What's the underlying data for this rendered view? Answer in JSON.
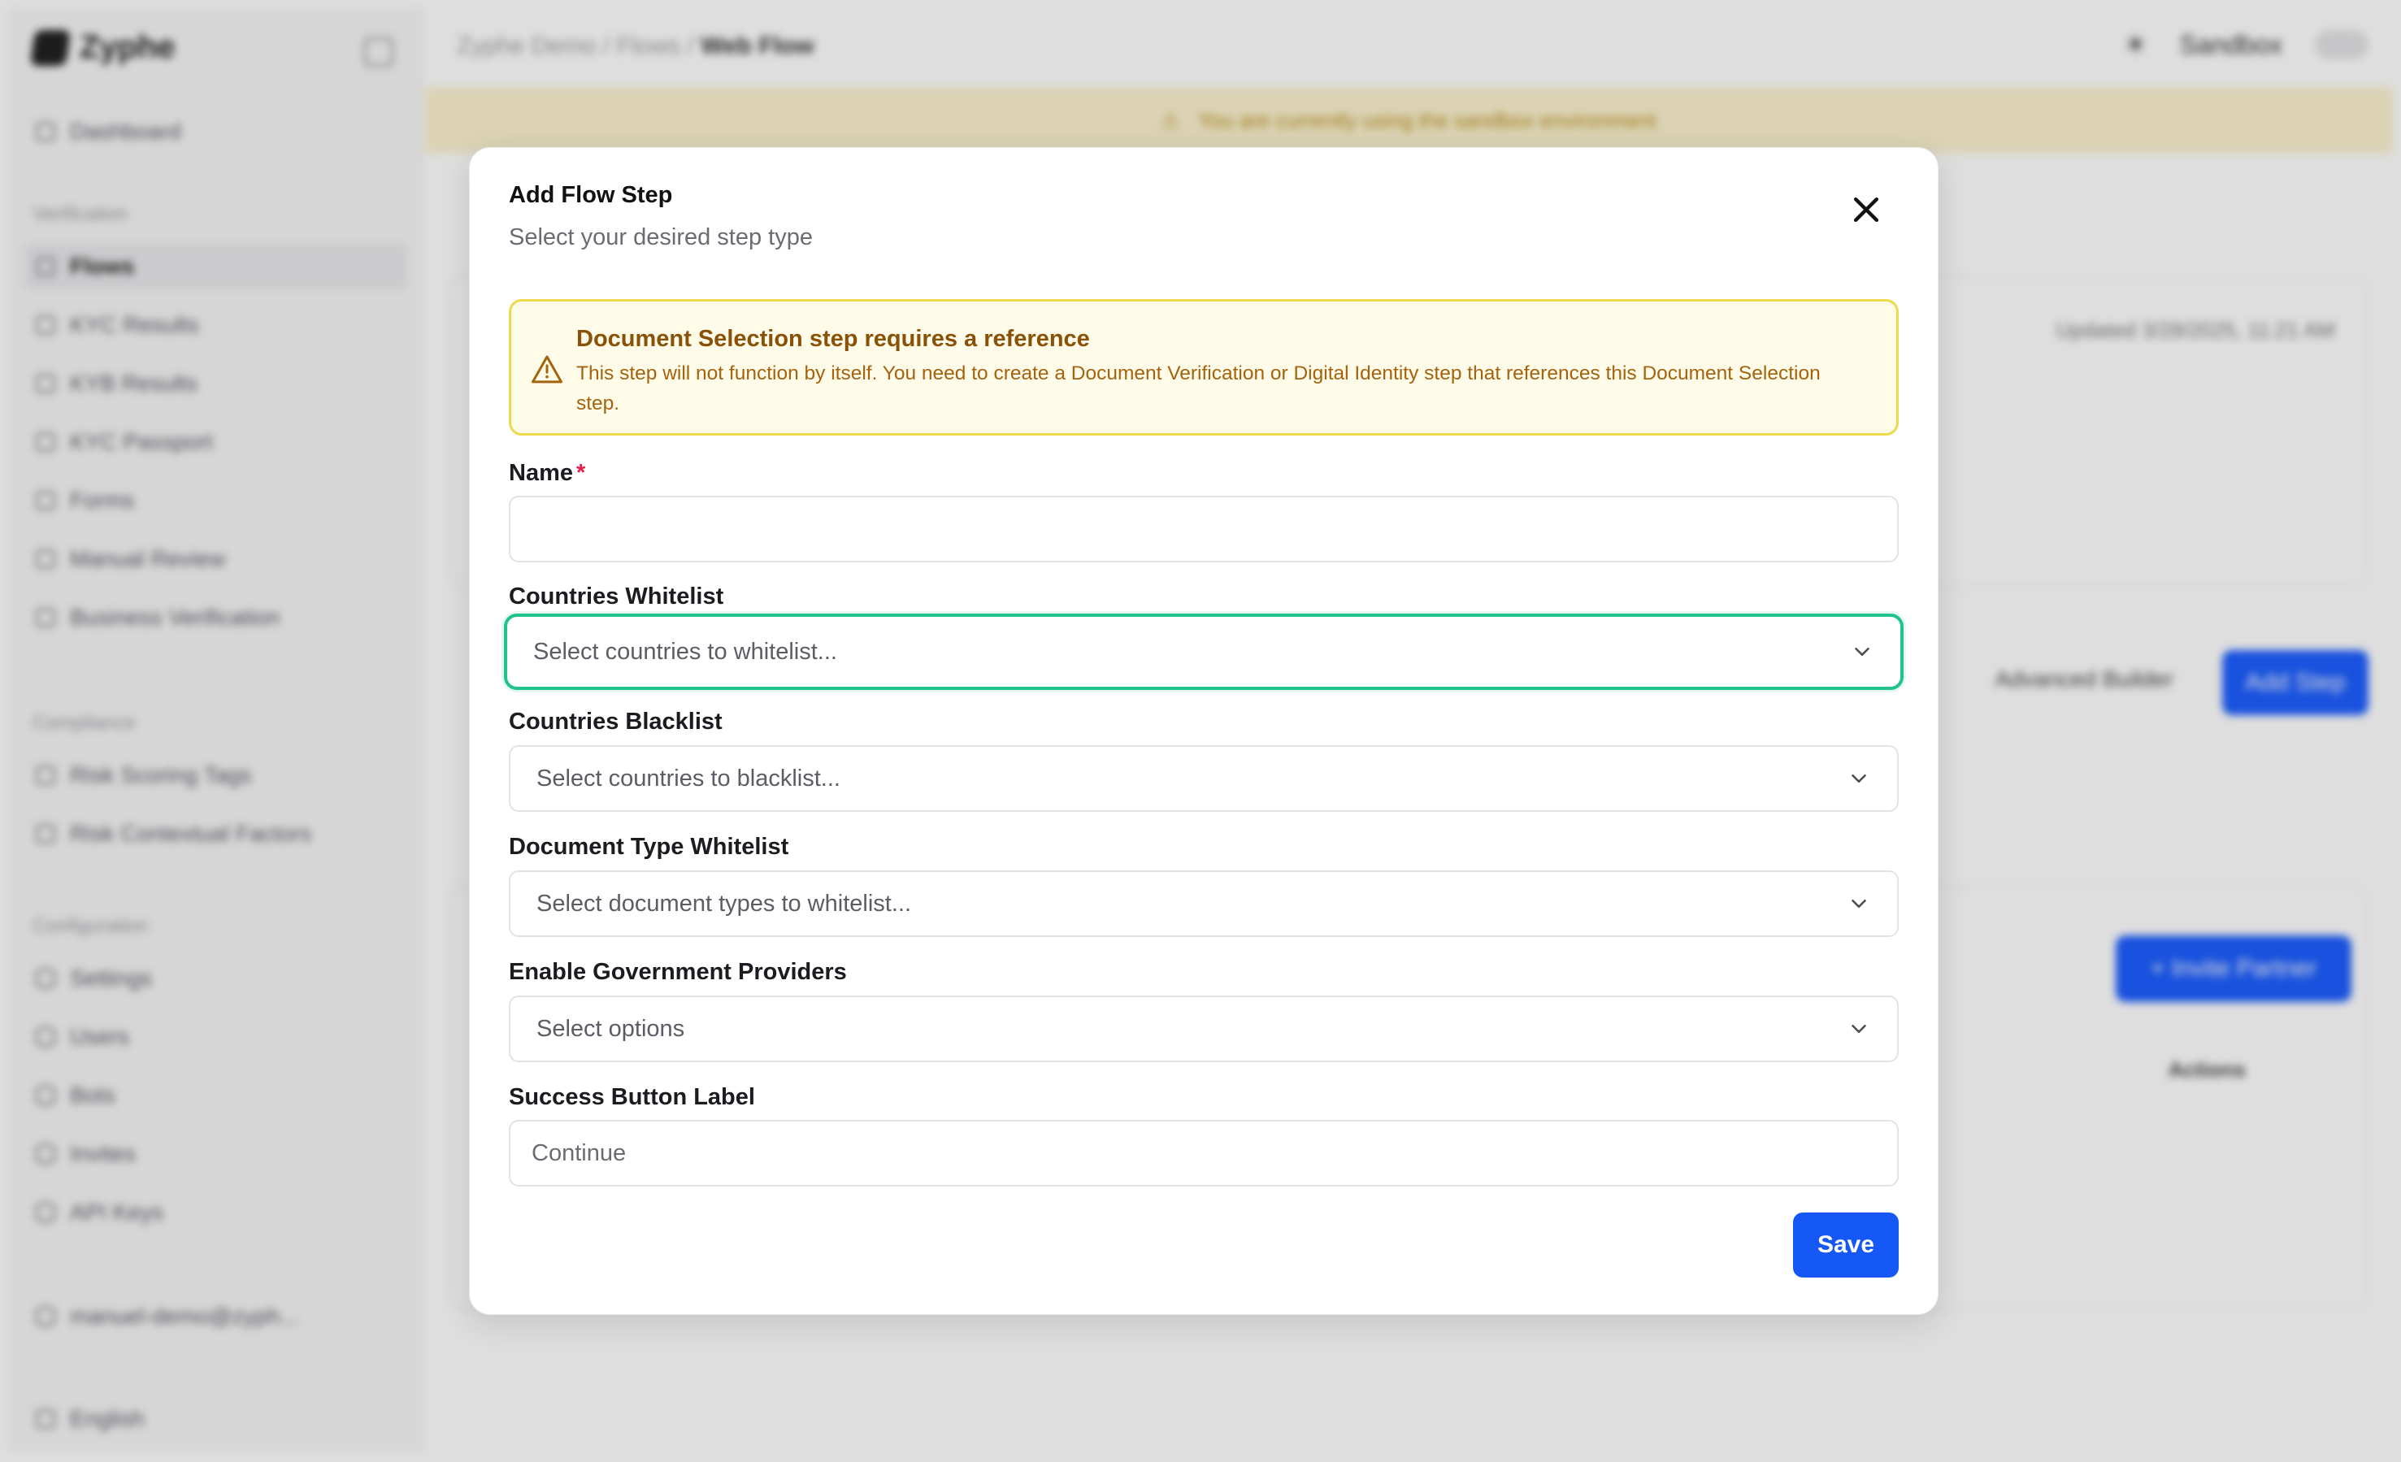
{
  "background": {
    "app_name": "Zyphe",
    "breadcrumb": [
      "Zyphe Demo",
      "Flows",
      "Web Flow"
    ],
    "environment": "Sandbox",
    "banner_text": "You are currently using the sandbox environment",
    "sidebar": {
      "top_item": "Dashboard",
      "groups": [
        {
          "title": "Verification",
          "items": [
            "Flows",
            "KYC Results",
            "KYB Results",
            "KYC Passport",
            "Forms",
            "Manual Review",
            "Business Verification"
          ]
        },
        {
          "title": "Compliance",
          "items": [
            "Risk Scoring Tags",
            "Risk Contextual Factors"
          ]
        },
        {
          "title": "Configuration",
          "items": [
            "Settings",
            "Users",
            "Bots",
            "Invites",
            "API Keys"
          ]
        }
      ],
      "user_email": "manuel-demo@zyph...",
      "language": "English"
    },
    "main": {
      "updated_text": "Updated 3/28/2025, 11:21 AM",
      "advanced_builder_label": "Advanced Builder",
      "add_step_label": "Add Step",
      "invite_partner_label": "+ Invite Partner",
      "actions_header": "Actions"
    }
  },
  "modal": {
    "title": "Add Flow Step",
    "subtitle": "Select your desired step type",
    "alert": {
      "title": "Document Selection step requires a reference",
      "body": "This step will not function by itself. You need to create a Document Verification or Digital Identity step that references this Document Selection step."
    },
    "fields": {
      "name": {
        "label": "Name",
        "required_mark": "*",
        "value": ""
      },
      "countries_whitelist": {
        "label": "Countries Whitelist",
        "placeholder": "Select countries to whitelist..."
      },
      "countries_blacklist": {
        "label": "Countries Blacklist",
        "placeholder": "Select countries to blacklist..."
      },
      "document_type_whitelist": {
        "label": "Document Type Whitelist",
        "placeholder": "Select document types to whitelist..."
      },
      "government_providers": {
        "label": "Enable Government Providers",
        "placeholder": "Select options"
      },
      "success_button_label": {
        "label": "Success Button Label",
        "value": "Continue"
      }
    },
    "save_label": "Save"
  },
  "colors": {
    "primary": "#1558f5",
    "focus_ring": "#20c38e",
    "warning_bg": "#fefce8",
    "warning_border": "#ecd94d",
    "warning_text": "#a5620f",
    "required": "#e11d48"
  },
  "icons": {
    "close": "close-icon",
    "warning": "warning-triangle-icon",
    "chevron": "chevron-down-icon"
  }
}
